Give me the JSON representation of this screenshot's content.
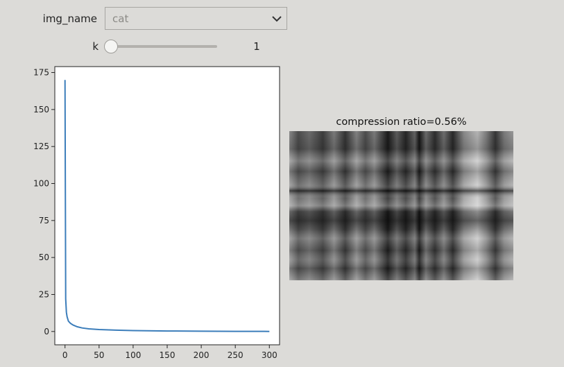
{
  "controls": {
    "dropdown": {
      "label": "img_name",
      "selected": "cat"
    },
    "slider": {
      "label": "k",
      "value": 1,
      "min": 1,
      "max": 300,
      "readout": "1"
    }
  },
  "chart_data": {
    "type": "line",
    "title": "",
    "xlabel": "",
    "ylabel": "",
    "xlim": [
      -15,
      315
    ],
    "ylim": [
      -9,
      179
    ],
    "grid": false,
    "x_ticks": [
      0,
      50,
      100,
      150,
      200,
      250,
      300
    ],
    "y_ticks": [
      0,
      25,
      50,
      75,
      100,
      125,
      150,
      175
    ],
    "color": "#3b7dba",
    "series": [
      {
        "x": [
          0,
          1,
          2,
          3,
          5,
          8,
          12,
          18,
          25,
          35,
          50,
          75,
          100,
          150,
          200,
          250,
          300
        ],
        "values": [
          170,
          22,
          13,
          10,
          7,
          5.5,
          4.3,
          3.2,
          2.4,
          1.8,
          1.3,
          0.9,
          0.6,
          0.35,
          0.2,
          0.1,
          0.05
        ]
      }
    ]
  },
  "compressed_image": {
    "title": "compression ratio=0.56%"
  }
}
